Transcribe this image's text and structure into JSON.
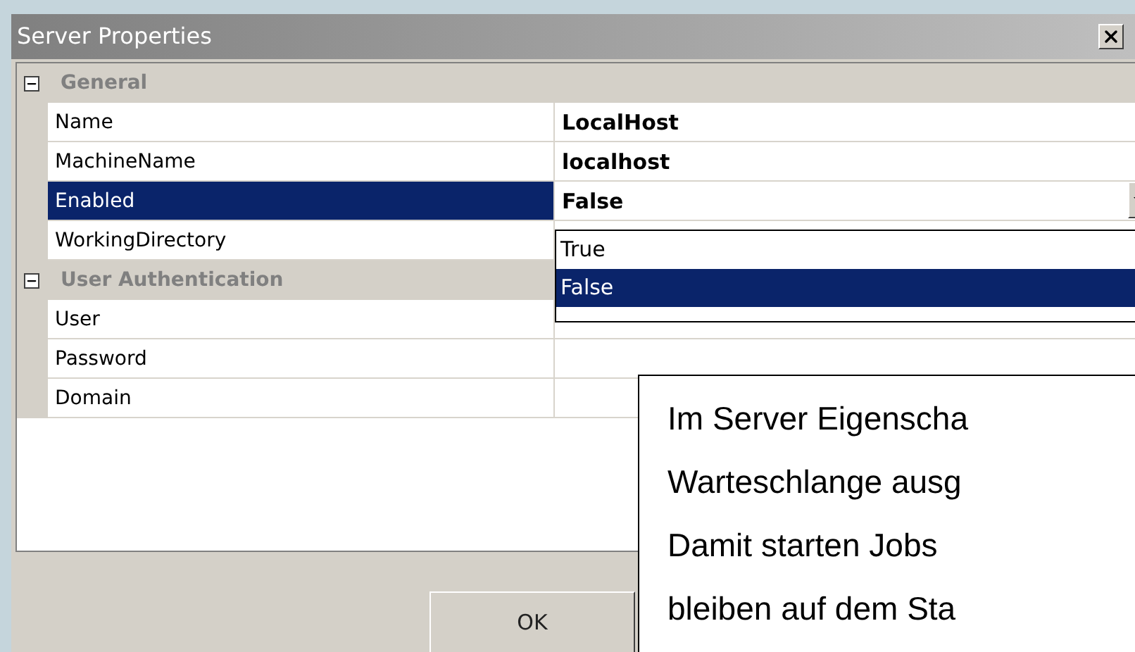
{
  "window": {
    "title": "Server Properties"
  },
  "categories": [
    {
      "name": "General",
      "expanded": true,
      "properties": [
        {
          "name": "Name",
          "value": "LocalHost",
          "selected": false
        },
        {
          "name": "MachineName",
          "value": "localhost",
          "selected": false
        },
        {
          "name": "Enabled",
          "value": "False",
          "selected": true,
          "dropdown": {
            "options": [
              {
                "label": "True",
                "selected": false
              },
              {
                "label": "False",
                "selected": true
              }
            ]
          }
        },
        {
          "name": "WorkingDirectory",
          "selected": false
        }
      ]
    },
    {
      "name": "User Authentication",
      "expanded": true,
      "properties": [
        {
          "name": "User",
          "selected": false
        },
        {
          "name": "Password",
          "selected": false
        },
        {
          "name": "Domain",
          "selected": false
        }
      ]
    }
  ],
  "buttons": [
    {
      "label": "OK"
    }
  ],
  "callout": {
    "lines": [
      "Im Server Eigenscha",
      "Warteschlange ausg",
      "Damit starten Jobs",
      "bleiben auf dem Sta"
    ]
  }
}
